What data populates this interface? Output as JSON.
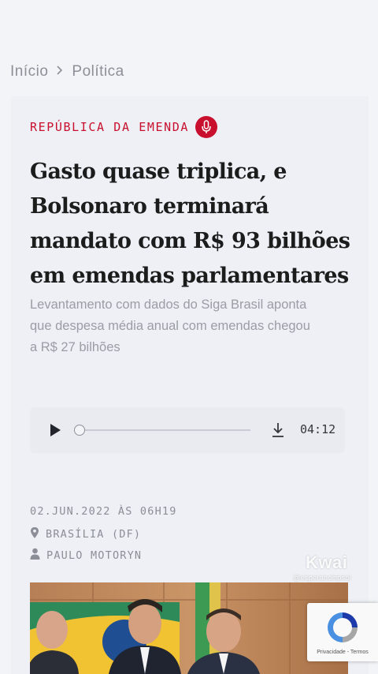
{
  "breadcrumb": {
    "home": "Início",
    "section": "Política"
  },
  "article": {
    "kicker": "REPÚBLICA DA EMENDA",
    "headline_lines": [
      "Gasto quase triplica, e",
      "Bolsonaro terminará",
      "mandato com R$ 93 bilhões",
      "em emendas parlamentares"
    ],
    "subtitle_lines": [
      "Levantamento com dados do Siga Brasil aponta",
      "que despesa média anual com emendas chegou",
      "a R$ 27 bilhões"
    ],
    "date": "02.JUN.2022 ÀS 06H19",
    "location": "BRASÍLIA (DF)",
    "author": "PAULO MOTORYN"
  },
  "player": {
    "duration": "04:12",
    "progress": 0
  },
  "overlay": {
    "watermark": "Kwai",
    "handle": "@esperancinpsol",
    "recaptcha_links": "Privacidade - Termos"
  },
  "colors": {
    "accent": "#c8102e",
    "background": "#f3f4f7",
    "card": "#eef0f6"
  },
  "icons": [
    "chevron-right-icon",
    "microphone-icon",
    "play-icon",
    "download-icon",
    "map-pin-icon",
    "user-icon",
    "recaptcha-icon"
  ]
}
